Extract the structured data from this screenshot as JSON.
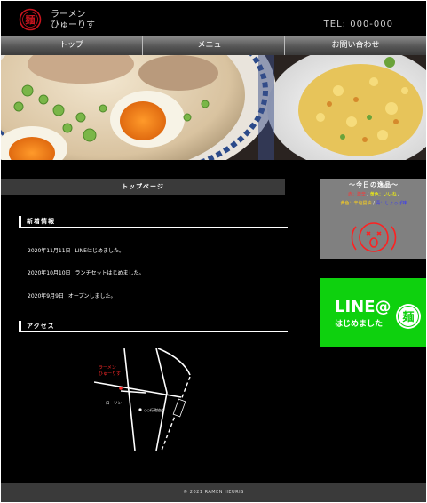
{
  "header": {
    "brand_line1": "ラーメン",
    "brand_line2": "ひゅーりす",
    "tel": "TEL: 000-000"
  },
  "nav": {
    "items": [
      {
        "label": "トップ"
      },
      {
        "label": "メニュー"
      },
      {
        "label": "お問い合わせ"
      }
    ]
  },
  "main": {
    "page_title": "トップページ",
    "news_heading": "新着情報",
    "news": [
      {
        "date": "2020年11月11日",
        "text": "LINEはじめました。"
      },
      {
        "date": "2020年10月10日",
        "text": "ランチセットはじめました。"
      },
      {
        "date": "2020年9月9日",
        "text": "オープンしました。"
      }
    ],
    "access_heading": "アクセス",
    "map": {
      "shop_line1": "ラーメン",
      "shop_line2": "ひゅーりす",
      "lawson": "ローソン",
      "landmark": "○○行政協会"
    }
  },
  "sidebar": {
    "special": {
      "title": "〜今日の逸品〜",
      "row1": [
        {
          "text": "赤：激辛",
          "color": "#ff3333"
        },
        {
          "text": "黄色：いいね",
          "color": "#ffff00"
        }
      ],
      "row2": [
        {
          "text": "黄色：辛塩醤油",
          "color": "#ffd21a"
        },
        {
          "text": "青：しょっぱ味",
          "color": "#3333ff"
        }
      ],
      "face_color": "#ff2020"
    },
    "line_banner": {
      "title": "LINE@",
      "subtitle": "はじめました"
    }
  },
  "footer": {
    "copyright": "© 2021 RAMEN HEURIS"
  },
  "colors": {
    "background": "#000000",
    "nav_gradient_top": "#8a8a8a",
    "bar": "#3a3a3a",
    "line_green": "#0ed10e",
    "logo_red": "#c8141e"
  }
}
